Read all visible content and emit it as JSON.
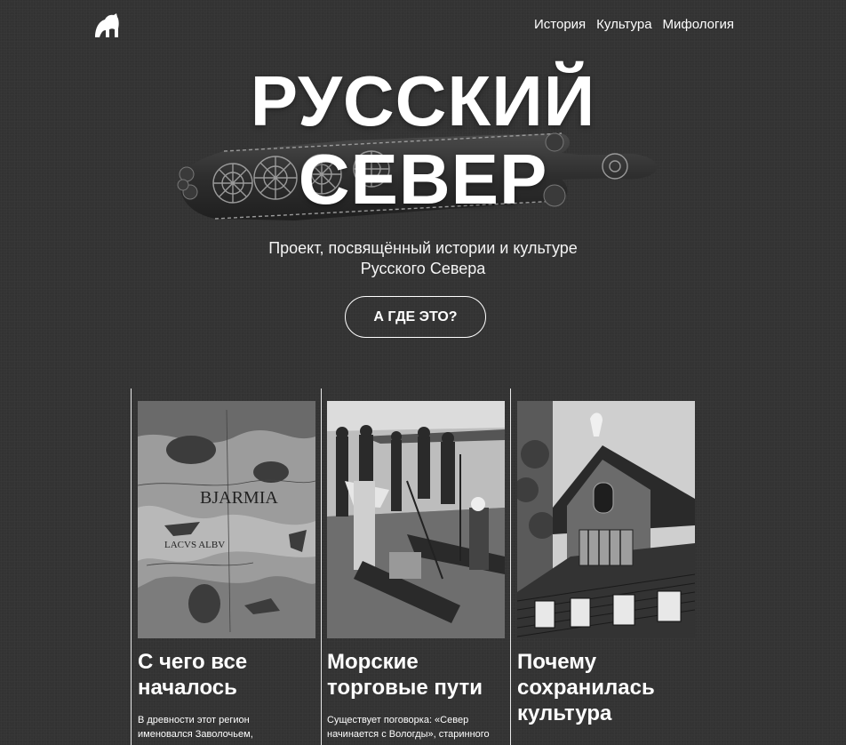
{
  "nav": {
    "items": [
      {
        "label": "История"
      },
      {
        "label": "Культура"
      },
      {
        "label": "Мифология"
      }
    ]
  },
  "hero": {
    "title_line1": "РУССКИЙ",
    "title_line2": "СЕВЕР",
    "subtitle_line1": "Проект, посвящённый истории и культуре",
    "subtitle_line2": "Русского Севера",
    "cta_label": "А ГДЕ ЭТО?"
  },
  "cards": [
    {
      "title_line1": "С чего все",
      "title_line2": "началось",
      "title_line3": "",
      "text_line1": "В древности этот регион",
      "text_line2": "именовался Заволочьем,",
      "map_label": "BJARMIA",
      "map_label2": "LACVS ALBV"
    },
    {
      "title_line1": "Морские",
      "title_line2": "торговые пути",
      "title_line3": "",
      "text_line1": "Существует поговорка: «Север",
      "text_line2": "начинается с Вологды», старинного"
    },
    {
      "title_line1": "Почему",
      "title_line2": "сохранилась",
      "title_line3": "культура",
      "text_line1": "",
      "text_line2": ""
    }
  ],
  "colors": {
    "background": "#333333",
    "text": "#ffffff"
  },
  "icons": {
    "logo": "horse-icon"
  }
}
